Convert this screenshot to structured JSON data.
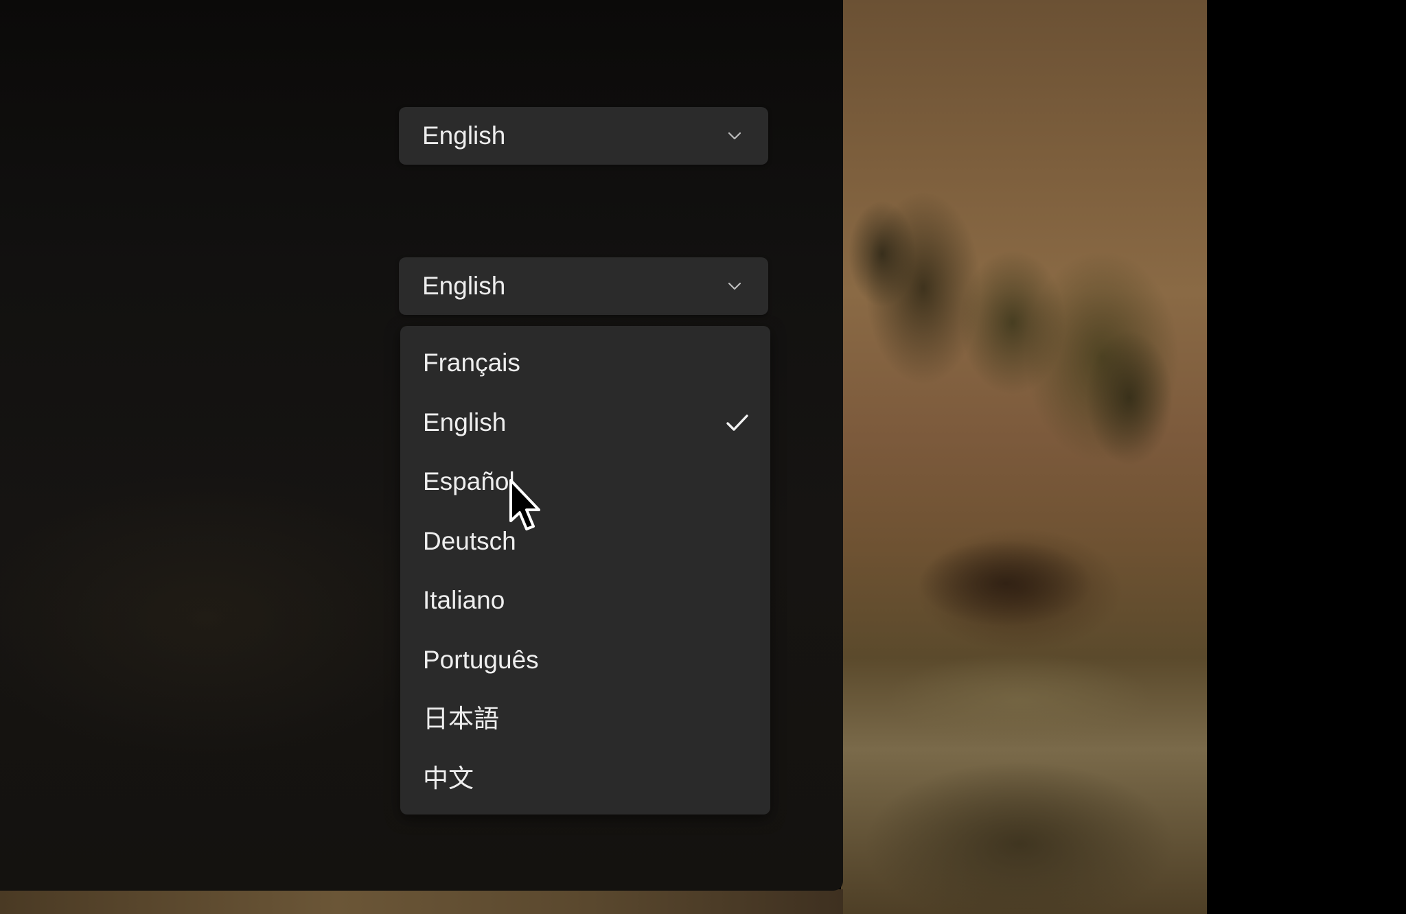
{
  "language_select_1": {
    "value": "English",
    "chevron_icon": "chevron-down"
  },
  "language_select_2": {
    "value": "English",
    "chevron_icon": "chevron-down",
    "expanded": true
  },
  "language_menu": {
    "items": [
      {
        "label": "Français",
        "selected": false
      },
      {
        "label": "English",
        "selected": true
      },
      {
        "label": "Español",
        "selected": false
      },
      {
        "label": "Deutsch",
        "selected": false
      },
      {
        "label": "Italiano",
        "selected": false
      },
      {
        "label": "Português",
        "selected": false
      },
      {
        "label": "日本語",
        "selected": false
      },
      {
        "label": "中文",
        "selected": false
      }
    ],
    "check_icon": "checkmark",
    "hovered_item": "Español"
  },
  "colors": {
    "panel_bg": "#141210",
    "control_bg": "#2b2b2b",
    "menu_bg": "#2a2a2a",
    "text": "#ededed"
  },
  "cursor": {
    "icon": "arrow-pointer"
  }
}
